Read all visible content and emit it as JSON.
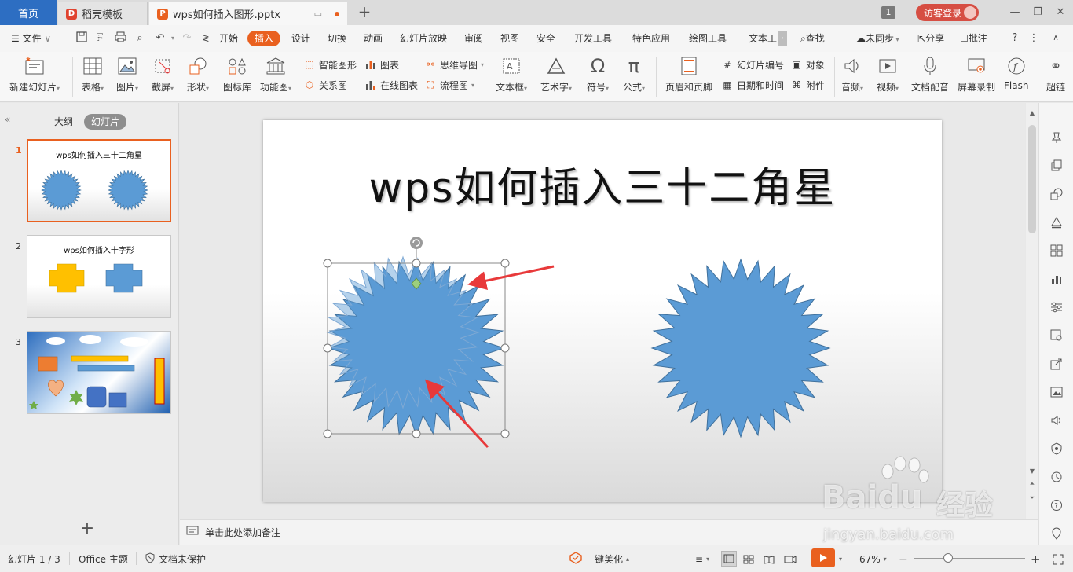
{
  "titlebar": {
    "home_tab": "首页",
    "templates_tab": "稻壳模板",
    "file_tab": "wps如何插入图形.pptx",
    "badge": "1",
    "login": "访客登录"
  },
  "menu": {
    "file": "文件",
    "items": [
      "开始",
      "插入",
      "设计",
      "切换",
      "动画",
      "幻灯片放映",
      "审阅",
      "视图",
      "安全",
      "开发工具",
      "特色应用",
      "绘图工具",
      "文本工"
    ],
    "active": "插入",
    "search": "查找",
    "sync": "未同步",
    "share": "分享",
    "comment": "批注"
  },
  "ribbon": {
    "new_slide": "新建幻灯片",
    "table": "表格",
    "picture": "图片",
    "screenshot": "截屏",
    "shape": "形状",
    "icon_lib": "图标库",
    "function_chart": "功能图",
    "smart_graphic": "智能图形",
    "chart": "图表",
    "mind_map": "思维导图",
    "relation": "关系图",
    "online_chart": "在线图表",
    "flowchart": "流程图",
    "textbox": "文本框",
    "wordart": "艺术字",
    "symbol": "符号",
    "formula": "公式",
    "header_footer": "页眉和页脚",
    "slide_number": "幻灯片编号",
    "object": "对象",
    "datetime": "日期和时间",
    "attachment": "附件",
    "audio": "音频",
    "video": "视频",
    "doc_dub": "文档配音",
    "screen_record": "屏幕录制",
    "flash": "Flash",
    "hyperlink": "超链"
  },
  "panel": {
    "outline_tab": "大纲",
    "slides_tab": "幻灯片",
    "slides": [
      {
        "num": "1",
        "title": "wps如何插入三十二角星"
      },
      {
        "num": "2",
        "title": "wps如何插入十字形"
      },
      {
        "num": "3",
        "title": ""
      }
    ]
  },
  "slide": {
    "title": "wps如何插入三十二角星"
  },
  "notes": {
    "placeholder": "单击此处添加备注"
  },
  "status": {
    "slide_counter": "幻灯片 1 / 3",
    "theme": "Office 主题",
    "protect": "文档未保护",
    "beautify": "一键美化",
    "zoom": "67%"
  },
  "watermark": {
    "brand": "Baidu",
    "brand_cn": "经验",
    "url": "jingyan.baidu.com"
  },
  "colors": {
    "accent": "#e9601f",
    "home_tab": "#2d6ec2",
    "star_fill": "#5b9bd5",
    "star_stroke": "#41719c",
    "arrow": "#e8393a"
  }
}
